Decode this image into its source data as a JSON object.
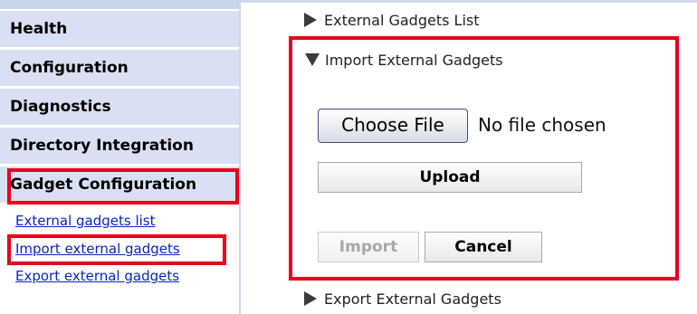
{
  "sidebar": {
    "sections": [
      {
        "label": "Health"
      },
      {
        "label": "Configuration"
      },
      {
        "label": "Diagnostics"
      },
      {
        "label": "Directory Integration"
      },
      {
        "label": "Gadget Configuration"
      }
    ],
    "links": [
      {
        "label": "External gadgets list"
      },
      {
        "label": "Import external gadgets"
      },
      {
        "label": "Export external gadgets"
      }
    ]
  },
  "main": {
    "external_list_label": "External Gadgets List",
    "import_panel": {
      "title": "Import External Gadgets",
      "choose_file_label": "Choose File",
      "file_status": "No file chosen",
      "upload_label": "Upload",
      "import_label": "Import",
      "cancel_label": "Cancel"
    },
    "export_label": "Export External Gadgets"
  },
  "colors": {
    "highlight": "#e8001c",
    "nav_background": "#d9e0f3",
    "link": "#0a24c2"
  }
}
